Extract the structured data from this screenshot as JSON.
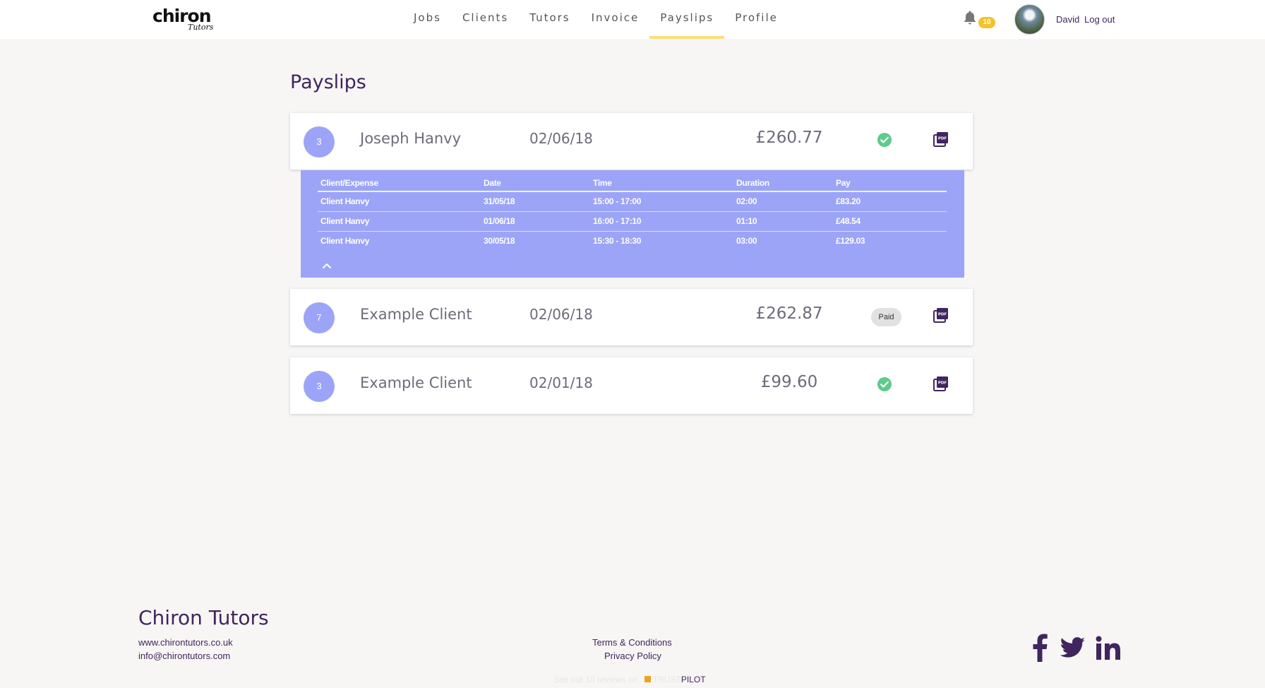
{
  "header": {
    "logo": {
      "word": "chiron",
      "script": "Tutors"
    },
    "nav": [
      {
        "label": "Jobs",
        "active": false
      },
      {
        "label": "Clients",
        "active": false
      },
      {
        "label": "Tutors",
        "active": false
      },
      {
        "label": "Invoice",
        "active": false
      },
      {
        "label": "Payslips",
        "active": true
      },
      {
        "label": "Profile",
        "active": false
      }
    ],
    "notifications_count": "10",
    "user_name": "David",
    "logout_label": "Log out"
  },
  "page_title": "Payslips",
  "payslips": [
    {
      "count": "3",
      "client": "Joseph Hanvy",
      "date": "02/06/18",
      "amount": "£260.77",
      "status": "check-icon"
    },
    {
      "count": "7",
      "client": "Example Client",
      "date": "02/06/18",
      "amount": "£262.87",
      "status": "Paid"
    },
    {
      "count": "3",
      "client": "Example Client",
      "date": "02/01/18",
      "amount": "£99.60",
      "status": "check-icon"
    }
  ],
  "detail": {
    "columns": [
      "Client/Expense",
      "Date",
      "Time",
      "Duration",
      "Pay"
    ],
    "rows": [
      [
        "Client Hanvy",
        "31/05/18",
        "15:00 - 17:00",
        "02:00",
        "£83.20"
      ],
      [
        "Client Hanvy",
        "01/06/18",
        "16:00 - 17:10",
        "01:10",
        "£48.54"
      ],
      [
        "Client Hanvy",
        "30/05/18",
        "15:30 - 18:30",
        "03:00",
        "£129.03"
      ]
    ]
  },
  "footer": {
    "title": "Chiron Tutors",
    "website": "www.chirontutors.co.uk",
    "email": "info@chirontutors.com",
    "terms": "Terms & Conditions",
    "privacy": "Privacy Policy",
    "trustpilot": {
      "pre": "See our",
      "count": "10",
      "mid": "reviews on",
      "brand": "TRUST",
      "pilot": "PILOT"
    },
    "social": [
      "facebook-icon",
      "twitter-icon",
      "linkedin-icon"
    ]
  },
  "colors": {
    "brand_purple": "#40255f",
    "accent_lavender": "#9ca4f7",
    "nav_underline": "#fbe076",
    "badge_yellow": "#f4c22a",
    "success_green": "#5dcb8b"
  }
}
